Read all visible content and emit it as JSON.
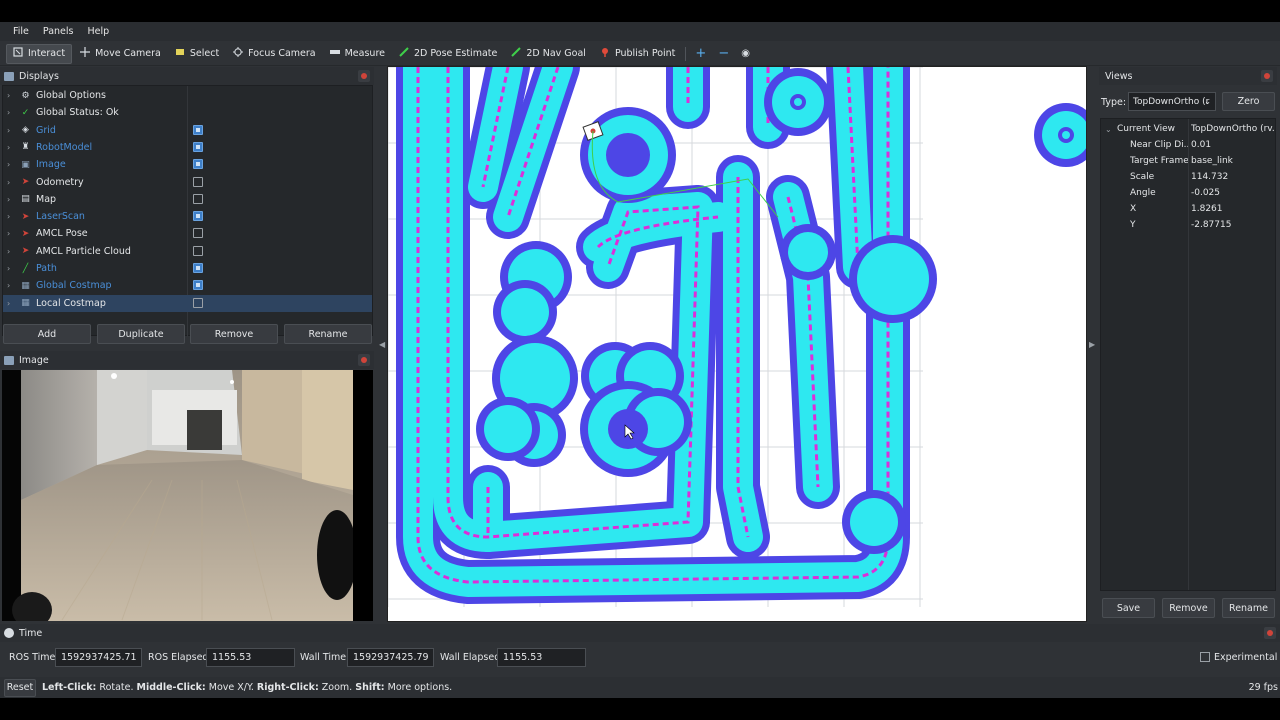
{
  "menu": [
    "File",
    "Panels",
    "Help"
  ],
  "toolbar": {
    "tools": [
      {
        "label": "Interact",
        "icon": "interact-icon",
        "active": true
      },
      {
        "label": "Move Camera",
        "icon": "move-camera-icon"
      },
      {
        "label": "Select",
        "icon": "select-icon"
      },
      {
        "label": "Focus Camera",
        "icon": "focus-camera-icon"
      },
      {
        "label": "Measure",
        "icon": "measure-icon"
      },
      {
        "label": "2D Pose Estimate",
        "icon": "pose-estimate-icon"
      },
      {
        "label": "2D Nav Goal",
        "icon": "nav-goal-icon"
      },
      {
        "label": "Publish Point",
        "icon": "publish-point-icon"
      }
    ],
    "plus": "+",
    "minus": "−",
    "eye": "◉"
  },
  "displays": {
    "title": "Displays",
    "items": [
      {
        "label": "Global Options",
        "icon": "gear-icon",
        "color": "#e4e6e8",
        "checkbox": null
      },
      {
        "label": "Global Status: Ok",
        "icon": "check-icon",
        "color": "#e4e6e8",
        "checkbox": null
      },
      {
        "label": "Grid",
        "icon": "grid-icon",
        "color": "#4a8fd8",
        "checkbox": true
      },
      {
        "label": "RobotModel",
        "icon": "robot-icon",
        "color": "#4a8fd8",
        "checkbox": true
      },
      {
        "label": "Image",
        "icon": "image-icon",
        "color": "#4a8fd8",
        "checkbox": true
      },
      {
        "label": "Odometry",
        "icon": "odometry-icon",
        "color": "#e4e6e8",
        "checkbox": false
      },
      {
        "label": "Map",
        "icon": "map-icon",
        "color": "#e4e6e8",
        "checkbox": false
      },
      {
        "label": "LaserScan",
        "icon": "laserscan-icon",
        "color": "#4a8fd8",
        "checkbox": true
      },
      {
        "label": "AMCL Pose",
        "icon": "pose-icon",
        "color": "#e4e6e8",
        "checkbox": false
      },
      {
        "label": "AMCL Particle Cloud",
        "icon": "particle-cloud-icon",
        "color": "#e4e6e8",
        "checkbox": false
      },
      {
        "label": "Path",
        "icon": "path-icon",
        "color": "#4a8fd8",
        "checkbox": true
      },
      {
        "label": "Global Costmap",
        "icon": "costmap-icon",
        "color": "#4a8fd8",
        "checkbox": true
      },
      {
        "label": "Local Costmap",
        "icon": "costmap-icon",
        "color": "#e4e6e8",
        "checkbox": false,
        "selected": true
      }
    ],
    "buttons": {
      "add": "Add",
      "duplicate": "Duplicate",
      "remove": "Remove",
      "rename": "Rename"
    }
  },
  "image_panel": {
    "title": "Image"
  },
  "views": {
    "title": "Views",
    "type_label": "Type:",
    "type_value": "TopDownOrtho (r",
    "zero": "Zero",
    "current_view": "Current View",
    "current_view_value": "TopDownOrtho (rv...",
    "props": [
      {
        "key": "Near Clip Di...",
        "value": "0.01"
      },
      {
        "key": "Target Frame",
        "value": "base_link"
      },
      {
        "key": "Scale",
        "value": "114.732"
      },
      {
        "key": "Angle",
        "value": "-0.025"
      },
      {
        "key": "X",
        "value": "1.8261"
      },
      {
        "key": "Y",
        "value": "-2.87715"
      }
    ],
    "buttons": {
      "save": "Save",
      "remove": "Remove",
      "rename": "Rename"
    }
  },
  "time": {
    "title": "Time",
    "ros_time_label": "ROS Time:",
    "ros_time": "1592937425.71",
    "ros_elapsed_label": "ROS Elapsed:",
    "ros_elapsed": "1155.53",
    "wall_time_label": "Wall Time:",
    "wall_time": "1592937425.79",
    "wall_elapsed_label": "Wall Elapsed:",
    "wall_elapsed": "1155.53",
    "experimental": "Experimental"
  },
  "status": {
    "reset": "Reset",
    "left_click": "Left-Click:",
    "left_click_desc": "Rotate.",
    "middle_click": "Middle-Click:",
    "middle_click_desc": "Move X/Y.",
    "right_click": "Right-Click:",
    "right_click_desc": "Zoom.",
    "shift": "Shift:",
    "shift_desc": "More options.",
    "fps": "29 fps"
  },
  "colors": {
    "costmap_outer": "#4d46e6",
    "costmap_inner": "#2ee8f0",
    "lethal": "#f019d6",
    "grid": "#d6d9dc",
    "accent": "#3e7fc8"
  }
}
